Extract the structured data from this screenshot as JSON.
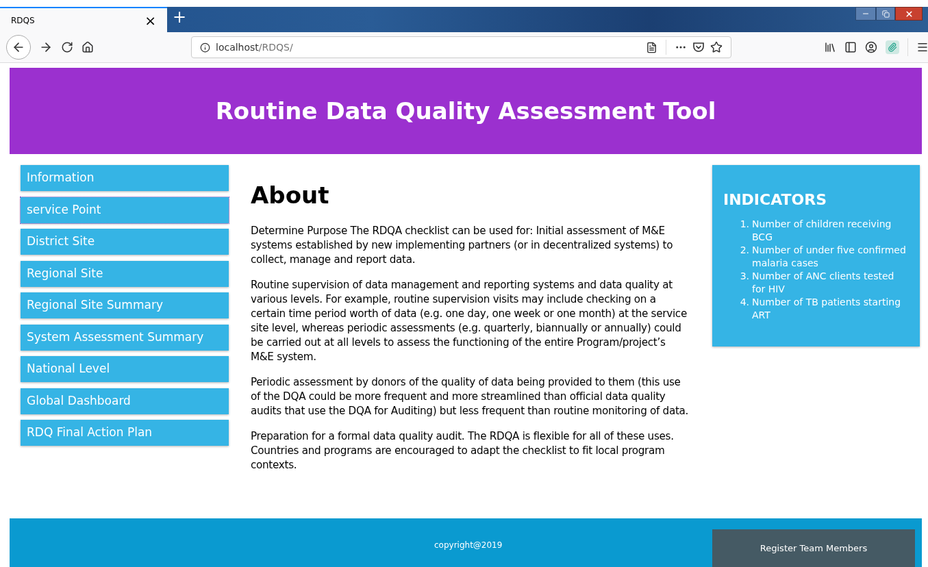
{
  "browser": {
    "tab": {
      "title": "RDQS",
      "close": "×"
    },
    "new_tab": "+",
    "url": {
      "host": "localhost",
      "path": "/RDQS/"
    }
  },
  "header": {
    "title": "Routine Data Quality Assessment Tool"
  },
  "sidebar": {
    "items": [
      {
        "label": "Information",
        "selected": false
      },
      {
        "label": "service Point",
        "selected": true
      },
      {
        "label": "District Site",
        "selected": false
      },
      {
        "label": "Regional Site",
        "selected": false
      },
      {
        "label": "Regional Site Summary",
        "selected": false
      },
      {
        "label": "System Assessment Summary",
        "selected": false
      },
      {
        "label": "National Level",
        "selected": false
      },
      {
        "label": "Global Dashboard",
        "selected": false
      },
      {
        "label": "RDQ Final Action Plan",
        "selected": false
      }
    ]
  },
  "main": {
    "heading": "About",
    "paragraphs": [
      "Determine Purpose The RDQA checklist can be used for: Initial assessment of M&E systems established by new implementing partners (or in decentralized systems) to collect, manage and report data.",
      "Routine supervision of data management and reporting systems and data quality at various levels. For example, routine supervision visits may include checking on a certain time period worth of data (e.g. one day, one week or one month) at the service site level, whereas periodic assessments (e.g. quarterly, biannually or annually) could be carried out at all levels to assess the functioning of the entire Program/project’s M&E system.",
      "Periodic assessment by donors of the quality of data being provided to them (this use of the DQA could be more frequent and more streamlined than official data quality audits that use the DQA for Auditing) but less frequent than routine monitoring of data.",
      "Preparation for a formal data quality audit. The RDQA is flexible for all of these uses. Countries and programs are encouraged to adapt the checklist to fit local program contexts."
    ]
  },
  "indicators": {
    "title": "INDICATORS",
    "items": [
      {
        "number": "1.",
        "text": "Number of children receiving BCG"
      },
      {
        "number": "2.",
        "text": "Number of under five confirmed malaria cases"
      },
      {
        "number": "3.",
        "text": "Number of ANC clients tested for HIV"
      },
      {
        "number": "4.",
        "text": "Number of TB patients starting ART"
      }
    ]
  },
  "footer": {
    "copyright": "copyright@2019",
    "button": "Register Team Members"
  }
}
